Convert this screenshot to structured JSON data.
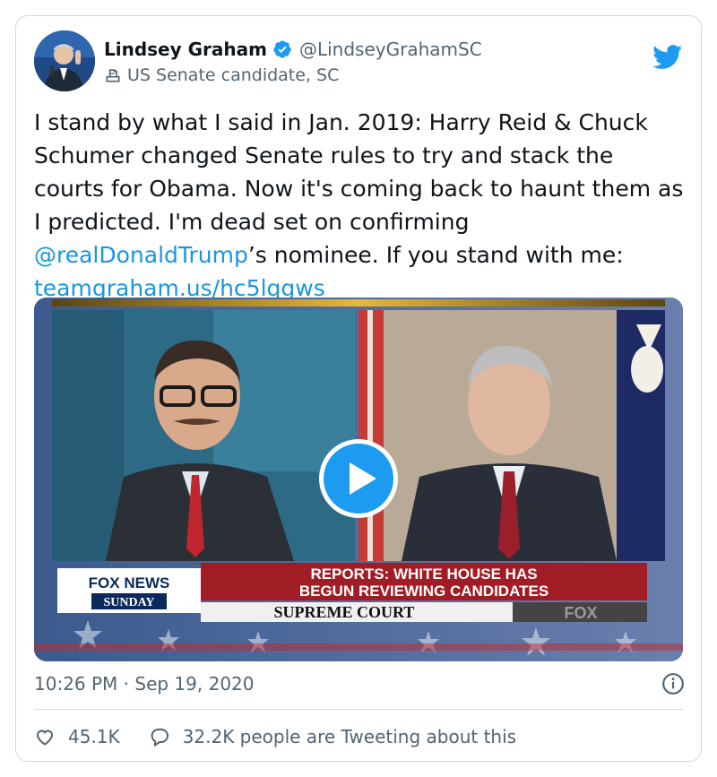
{
  "author": {
    "display_name": "Lindsey Graham",
    "handle": "@LindseyGrahamSC",
    "label": "US Senate candidate, SC"
  },
  "tweet": {
    "text_part1": "I stand by what I said in Jan. 2019: Harry Reid & Chuck Schumer changed Senate rules to try and stack the courts for Obama. Now it's coming back to haunt them as I predicted. I'm dead set on confirming ",
    "mention": "@realDonaldTrump",
    "text_part2": "’s nominee. If you stand with me: ",
    "link": "teamgraham.us/hc5lqgws"
  },
  "media": {
    "chyron_headline_1": "REPORTS: WHITE HOUSE HAS",
    "chyron_headline_2": "BEGUN REVIEWING CANDIDATES",
    "chyron_topic": "SUPREME COURT",
    "network_logo_top": "FOX NEWS",
    "network_logo_bottom": "SUNDAY",
    "corner_bug": "FOX"
  },
  "meta": {
    "timestamp": "10:26 PM · Sep 19, 2020"
  },
  "actions": {
    "likes": "45.1K",
    "conversation": "32.2K people are Tweeting about this"
  },
  "colors": {
    "link": "#1b95e0",
    "verified": "#1d9bf0",
    "twitter_blue": "#1d9bf0",
    "secondary_text": "#536471"
  }
}
